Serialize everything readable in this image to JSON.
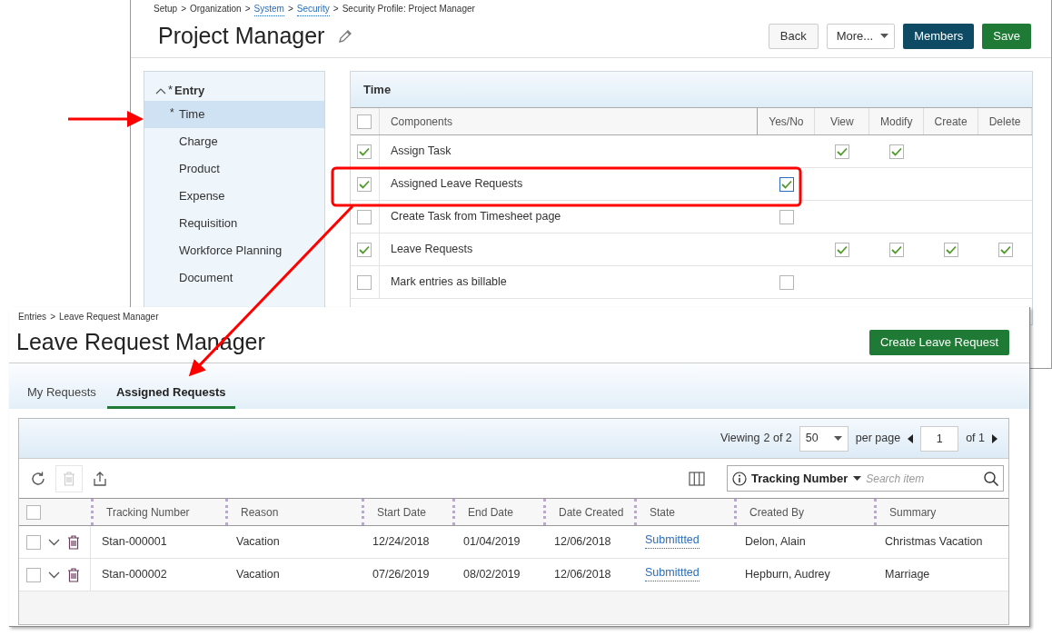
{
  "security_profile": {
    "breadcrumb": [
      {
        "text": "Setup",
        "link": false
      },
      {
        "text": "Organization",
        "link": false
      },
      {
        "text": "System",
        "link": true
      },
      {
        "text": "Security",
        "link": true
      },
      {
        "text": "Security Profile: Project Manager",
        "link": false
      }
    ],
    "separator": ">",
    "title": "Project Manager",
    "buttons": [
      {
        "label": "Back",
        "kind": "default"
      },
      {
        "label": "More...",
        "kind": "dropdown"
      },
      {
        "label": "Members",
        "kind": "dark"
      },
      {
        "label": "Save",
        "kind": "primary"
      }
    ],
    "sidebar": {
      "group": {
        "label": "Entry",
        "marker": "*",
        "expanded": true
      },
      "items": [
        {
          "label": "Time",
          "marker": "*",
          "selected": true
        },
        {
          "label": "Charge",
          "selected": false
        },
        {
          "label": "Product",
          "selected": false
        },
        {
          "label": "Expense",
          "selected": false
        },
        {
          "label": "Requisition",
          "selected": false
        },
        {
          "label": "Workforce Planning",
          "selected": false
        },
        {
          "label": "Document",
          "selected": false
        }
      ]
    },
    "panel": {
      "title": "Time",
      "header_checked": false,
      "columns": [
        "Components",
        "Yes/No",
        "View",
        "Modify",
        "Create",
        "Delete"
      ],
      "rows": [
        {
          "checked": true,
          "component": "Assign Task",
          "cells": [
            null,
            {
              "checked": true
            },
            {
              "checked": true
            },
            null,
            null
          ]
        },
        {
          "checked": true,
          "component": "Assigned Leave Requests",
          "cells": [
            {
              "checked": true,
              "focused": true
            },
            null,
            null,
            null,
            null
          ]
        },
        {
          "checked": false,
          "component": "Create Task from Timesheet page",
          "cells": [
            {
              "checked": false
            },
            null,
            null,
            null,
            null
          ]
        },
        {
          "checked": true,
          "component": "Leave Requests",
          "cells": [
            null,
            {
              "checked": true
            },
            {
              "checked": true
            },
            {
              "checked": true
            },
            {
              "checked": true
            }
          ]
        },
        {
          "checked": false,
          "component": "Mark entries as billable",
          "cells": [
            {
              "checked": false
            },
            null,
            null,
            null,
            null
          ]
        }
      ]
    }
  },
  "leave_request_manager": {
    "breadcrumb": [
      {
        "text": "Entries"
      },
      {
        "text": "Leave Request Manager"
      }
    ],
    "separator": ">",
    "title": "Leave Request Manager",
    "create_button": "Create Leave Request",
    "tabs": [
      {
        "label": "My Requests",
        "selected": false
      },
      {
        "label": "Assigned Requests",
        "selected": true
      }
    ],
    "pager": {
      "viewing": "Viewing",
      "count": "2 of 2",
      "page_size": "50",
      "per_page": "per page",
      "page": "1",
      "of": "of 1"
    },
    "toolbar": {
      "delete_disabled": true
    },
    "search": {
      "filter": "Tracking Number",
      "placeholder": "Search item"
    },
    "header_checked": false,
    "columns": [
      "Tracking Number",
      "Reason",
      "Start Date",
      "End Date",
      "Date Created",
      "State",
      "Created By",
      "Summary"
    ],
    "rows": [
      {
        "checked": false,
        "tracking_number": "Stan-000001",
        "reason": "Vacation",
        "start_date": "12/24/2018",
        "end_date": "01/04/2019",
        "date_created": "12/06/2018",
        "state": "Submittted",
        "created_by": "Delon, Alain",
        "summary": "Christmas Vacation"
      },
      {
        "checked": false,
        "tracking_number": "Stan-000002",
        "reason": "Vacation",
        "start_date": "07/26/2019",
        "end_date": "08/02/2019",
        "date_created": "12/06/2018",
        "state": "Submittted",
        "created_by": "Hepburn, Audrey",
        "summary": "Marriage"
      }
    ]
  }
}
